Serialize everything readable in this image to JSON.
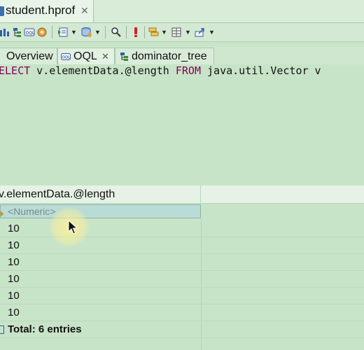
{
  "editor": {
    "tab_label": "student.hprof",
    "close_glyph": "✕"
  },
  "toolbar": {
    "icons": [
      "histogram-icon",
      "dominator-tree-icon",
      "oql-icon",
      "settings-gear-icon",
      "query-browser-icon",
      "heap-dump-overview-icon",
      "find-object-icon",
      "run-query-icon",
      "group-by-icon",
      "calculate-retained-icon",
      "export-icon"
    ]
  },
  "view_tabs": [
    {
      "label": "Overview"
    },
    {
      "label": "OQL",
      "close": "✕"
    },
    {
      "label": "dominator_tree"
    }
  ],
  "query": {
    "keyword_select": "ELECT",
    "part1": " v.elementData.@length ",
    "keyword_from": "FROM",
    "part2": " java.util.Vector v"
  },
  "results": {
    "column_header": "v.elementData.@length",
    "filter_placeholder": "<Numeric>",
    "rows": [
      "10",
      "10",
      "10",
      "10",
      "10",
      "10"
    ],
    "total": "Total: 6 entries"
  },
  "colors": {
    "background": "#c8e4c8",
    "keyword": "#7f0055",
    "filter_row": "#b9dcd6"
  }
}
